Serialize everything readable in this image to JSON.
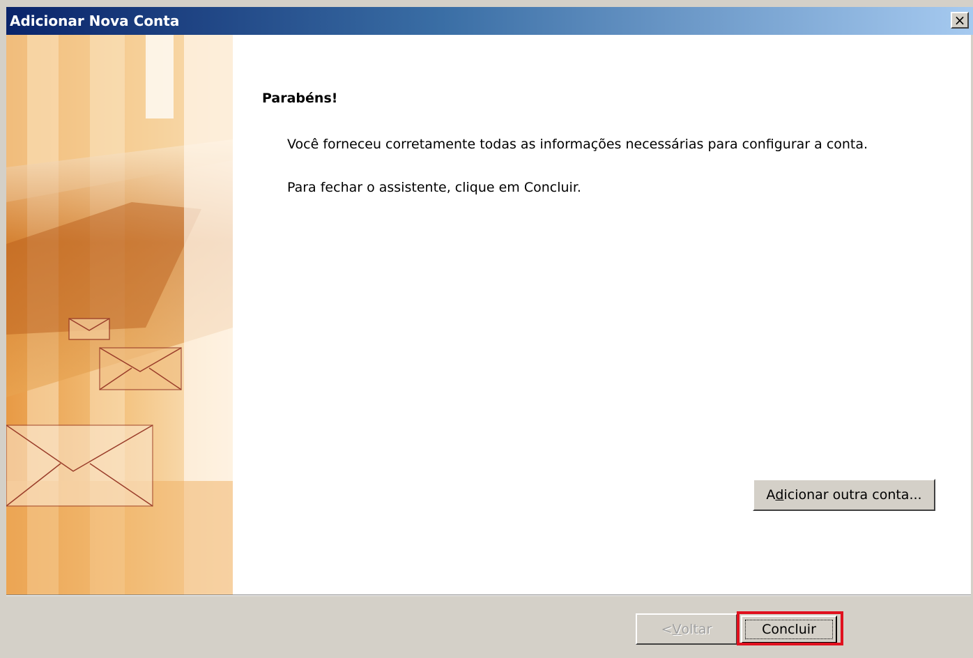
{
  "window": {
    "title": "Adicionar Nova Conta",
    "close_label": "×"
  },
  "wizard": {
    "heading": "Parabéns!",
    "message_1": "Você forneceu corretamente todas as informações necessárias para configurar a conta.",
    "message_2": "Para fechar o assistente, clique em Concluir."
  },
  "buttons": {
    "add_account": {
      "pre": "A",
      "accel": "d",
      "post": "icionar outra conta..."
    },
    "back": {
      "pre": "< ",
      "accel": "V",
      "post": "oltar"
    },
    "finish": "Concluir"
  },
  "colors": {
    "titlebar_start": "#0a246a",
    "titlebar_end": "#a6caf0",
    "highlight": "#e0101e",
    "art_orange": "#e39a3c"
  }
}
